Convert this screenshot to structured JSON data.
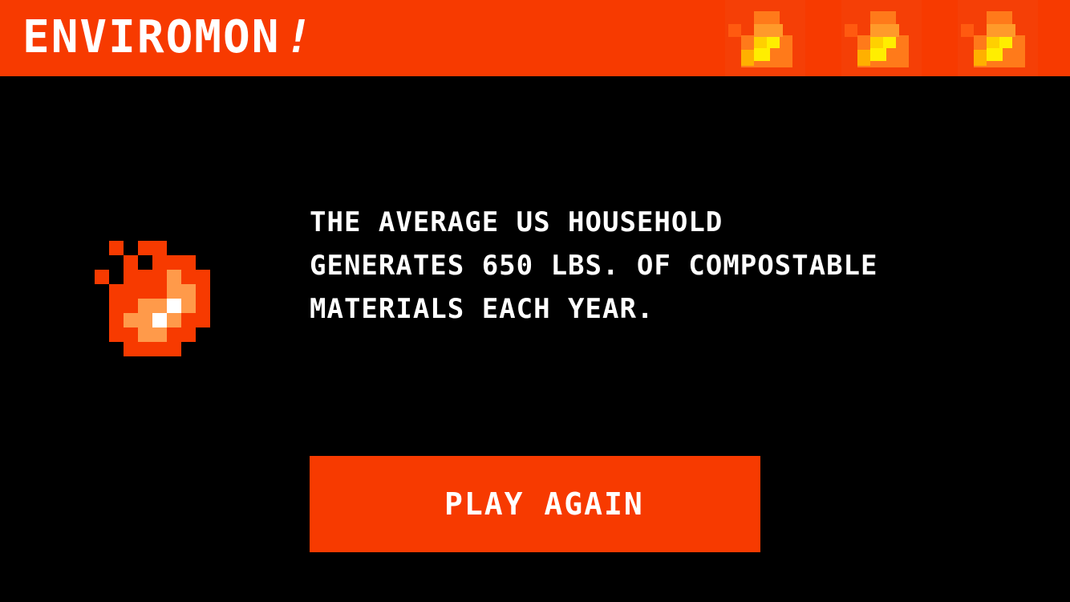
{
  "header": {
    "title": "ENVIROMON",
    "title_suffix": "!",
    "background_color": "#f73a00",
    "decoration_icon": "pixel-fire-icon"
  },
  "fact": {
    "icon": "pixel-fire-icon",
    "text": "THE AVERAGE US HOUSEHOLD GENERATES 650 LBS. OF COMPOSTABLE MATERIALS EACH YEAR."
  },
  "play_again": {
    "label": "PLAY AGAIN",
    "color": "#f73a00"
  },
  "colors": {
    "background": "#000000",
    "accent": "#f73a00",
    "fire_orange": "#ff9a4a",
    "fire_yellow": "#ffee00",
    "text": "#ffffff"
  }
}
